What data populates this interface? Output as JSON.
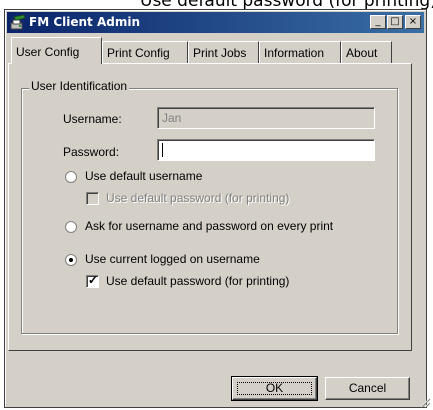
{
  "caption_strip": {
    "text": "Use default password (for printing)"
  },
  "window": {
    "title": "FM Client Admin",
    "icon": "fm-client-app-icon",
    "controls": {
      "minimize": "_",
      "maximize": "□",
      "close": "×"
    }
  },
  "tabs": [
    {
      "label": "User Config",
      "active": true
    },
    {
      "label": "Print Config",
      "active": false
    },
    {
      "label": "Print Jobs",
      "active": false
    },
    {
      "label": "Information",
      "active": false
    },
    {
      "label": "About",
      "active": false
    }
  ],
  "user_identification": {
    "legend": "User Identification",
    "username_label": "Username:",
    "username_value": "Jan",
    "password_label": "Password:",
    "password_value": "",
    "options": [
      {
        "label": "Use default username",
        "selected": false
      },
      {
        "label": "Ask for username and password on every print",
        "selected": false
      },
      {
        "label": "Use current logged on username",
        "selected": true
      }
    ],
    "default_password_disabled": {
      "label": "Use default password (for printing)",
      "checked": false,
      "enabled": false
    },
    "default_password_active": {
      "label": "Use default password (for printing)",
      "checked": true,
      "enabled": true
    }
  },
  "buttons": {
    "ok": "OK",
    "cancel": "Cancel"
  },
  "colors": {
    "titlebar_start": "#0a246a",
    "titlebar_end": "#3a6ea5",
    "face": "#d4d0c8",
    "disabled_text": "#808080"
  }
}
